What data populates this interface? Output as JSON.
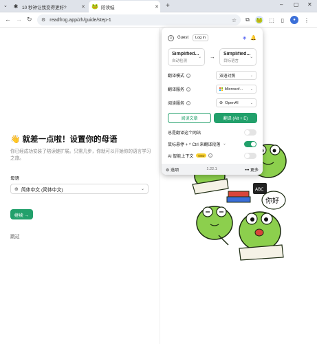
{
  "browser": {
    "tabs": [
      {
        "title": "10 秒钟让我变得更好?",
        "icon": "✱"
      },
      {
        "title": "陪读蛙",
        "icon": "🐸"
      }
    ],
    "new_tab": "+",
    "window_controls": [
      "–",
      "▢",
      "✕"
    ],
    "url": "readfrog.app/zh/guide/step-1"
  },
  "page": {
    "title": "👋 就差一点啦！设置你的母语",
    "description": "你已经成功安装了陪读蛙扩展。只需几步，你就可以开始你的语言学习之旅。",
    "lang_label": "母语",
    "lang_value": "简体中文 (简体中文)",
    "continue_label": "继续 →",
    "skip_label": "跳过"
  },
  "popup": {
    "guest_label": "Guest",
    "login_label": "Log in",
    "source_lang": {
      "name": "Simplified...",
      "sub": "自动检测"
    },
    "target_lang": {
      "name": "Simplified...",
      "sub": "目标语言"
    },
    "settings": [
      {
        "label": "翻译模式",
        "value": "双语对照"
      },
      {
        "label": "翻译服务",
        "value": "Microsof..."
      },
      {
        "label": "阅读服务",
        "value": "OpenAI"
      }
    ],
    "read_article_label": "阅读文章",
    "translate_label": "翻译 (Alt + E)",
    "toggles": [
      {
        "label": "总是翻译这个网站",
        "on": false
      },
      {
        "label": "鼠标悬停 + ^ Ctrl 来翻译段落",
        "on": true
      },
      {
        "label": "AI 智能上下文",
        "badge": "New",
        "on": false
      }
    ],
    "footer": {
      "options_label": "选项",
      "version": "1.22.1",
      "more_label": "更多"
    }
  },
  "illustration": {
    "sign_text": "你好",
    "book_text": "ABC"
  },
  "colors": {
    "accent": "#22a06b",
    "popup_shadow": "#999999",
    "badge": "#f7cf2c"
  }
}
